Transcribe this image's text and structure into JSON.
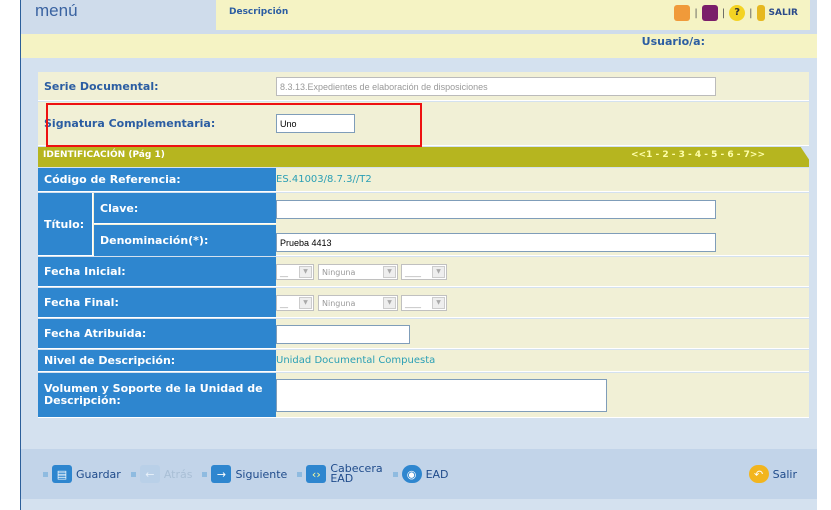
{
  "header": {
    "menu_label": "menú",
    "tab_label": "Descripción",
    "exit_label": "SALIR",
    "user_label": "Usuario/a:"
  },
  "form": {
    "serie": {
      "label": "Serie Documental:",
      "value": "8.3.13.Expedientes de elaboración de disposiciones"
    },
    "signatura": {
      "label": "Signatura Complementaria:",
      "value": "Uno"
    },
    "section": {
      "label": "IDENTIFICACIÓN (Pág 1)",
      "pager": "<<1 - 2 - 3 - 4 - 5 - 6 - 7>>"
    },
    "codigo": {
      "label": "Código de Referencia:",
      "value": "ES.41003/8.7.3//T2"
    },
    "titulo": {
      "label": "Título:",
      "clave_label": "Clave:",
      "clave_value": "",
      "denom_label": "Denominación(*):",
      "denom_value": "Prueba 4413"
    },
    "fecha_inicial": {
      "label": "Fecha Inicial:",
      "day": "__",
      "month": "Ninguna",
      "year": "____"
    },
    "fecha_final": {
      "label": "Fecha Final:",
      "day": "__",
      "month": "Ninguna",
      "year": "____"
    },
    "fecha_atribuida": {
      "label": "Fecha Atribuida:",
      "value": ""
    },
    "nivel": {
      "label": "Nivel de Descripción:",
      "value": "Unidad Documental Compuesta"
    },
    "volumen": {
      "label": "Volumen y Soporte de la Unidad de Descripción:",
      "value": ""
    }
  },
  "footer": {
    "guardar": "Guardar",
    "atras": "Atrás",
    "siguiente": "Siguiente",
    "cabecera_1": "Cabecera",
    "cabecera_2": "EAD",
    "ead": "EAD",
    "salir": "Salir"
  },
  "colors": {
    "label_blue": "#2e86cf",
    "highlight": "#e11111",
    "section_olive": "#b6b51f",
    "link_teal": "#2a9fb5"
  },
  "icons": [
    "flower-icon",
    "book-icon",
    "help-icon",
    "exit-door-icon",
    "save-icon",
    "back-arrow-icon",
    "next-arrow-icon",
    "code-brackets-icon",
    "eye-icon",
    "exit-arrow-icon"
  ]
}
